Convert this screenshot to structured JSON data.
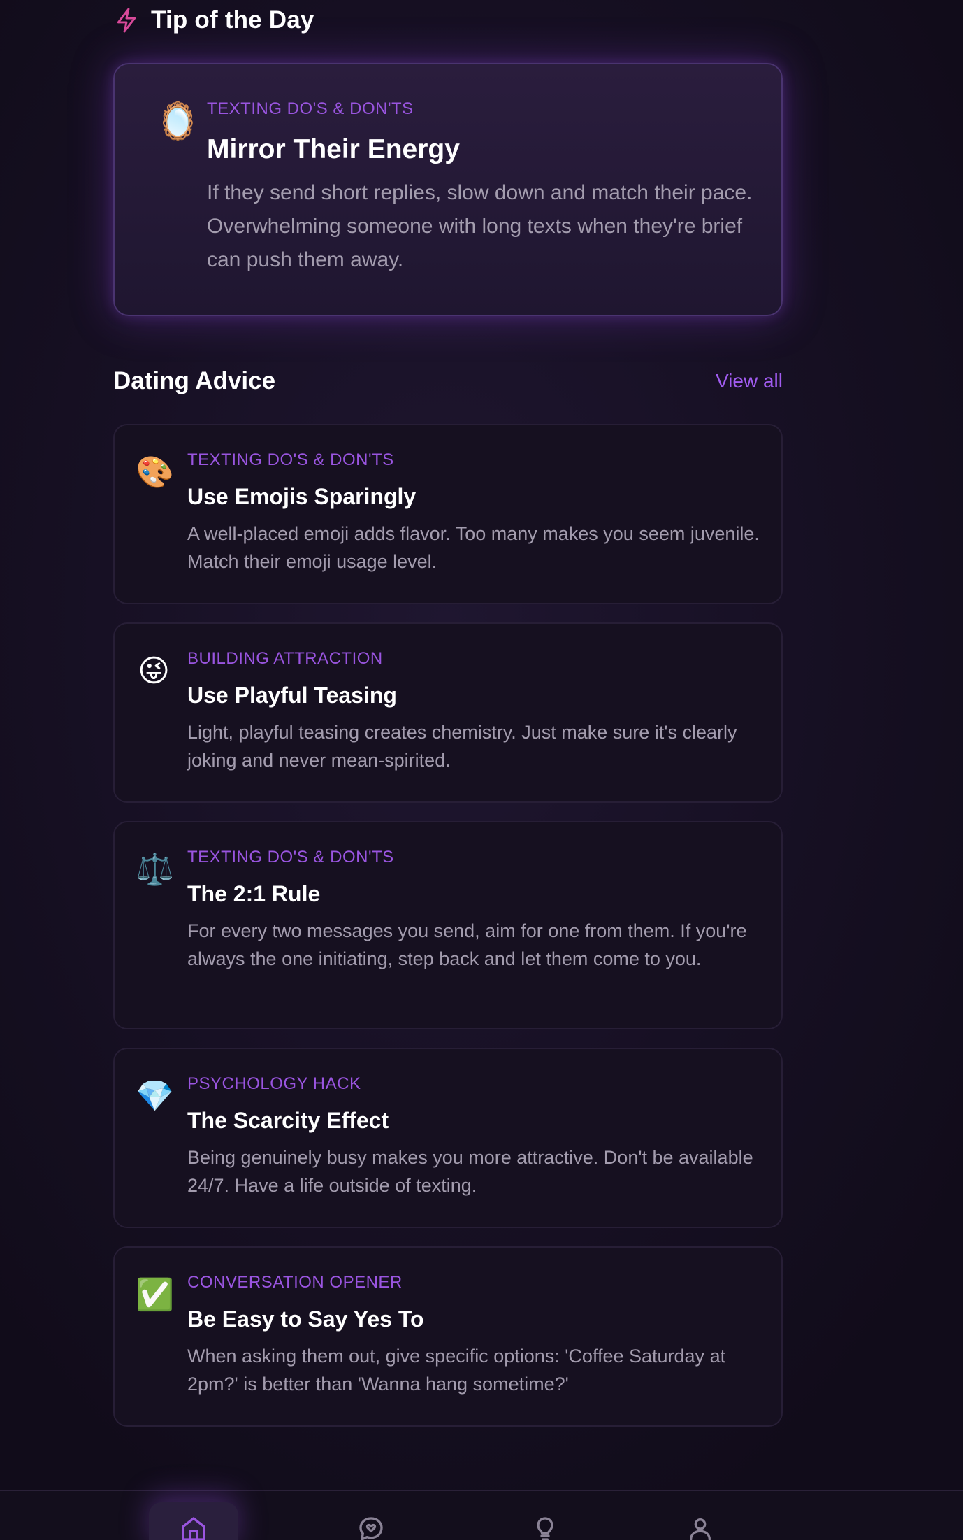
{
  "tip_of_day": {
    "heading": "Tip of the Day",
    "icon": "lightning-bolt-icon",
    "card": {
      "emoji": "🪞",
      "category": "TEXTING DO'S & DON'TS",
      "title": "Mirror Their Energy",
      "description": "If they send short replies, slow down and match their pace. Overwhelming someone with long texts when they're brief can push them away."
    }
  },
  "dating_advice": {
    "heading": "Dating Advice",
    "view_all_label": "View all",
    "items": [
      {
        "emoji": "🎨",
        "category": "TEXTING DO'S & DON'TS",
        "title": "Use Emojis Sparingly",
        "description": "A well-placed emoji adds flavor. Too many makes you seem juvenile. Match their emoji usage level."
      },
      {
        "emoji": "😜",
        "category": "BUILDING ATTRACTION",
        "title": "Use Playful Teasing",
        "description": "Light, playful teasing creates chemistry. Just make sure it's clearly joking and never mean-spirited."
      },
      {
        "emoji": "⚖️",
        "category": "TEXTING DO'S & DON'TS",
        "title": "The 2:1 Rule",
        "description": "For every two messages you send, aim for one from them. If you're always the one initiating, step back and let them come to you."
      },
      {
        "emoji": "💎",
        "category": "PSYCHOLOGY HACK",
        "title": "The Scarcity Effect",
        "description": "Being genuinely busy makes you more attractive. Don't be available 24/7. Have a life outside of texting."
      },
      {
        "emoji": "✅",
        "category": "CONVERSATION OPENER",
        "title": "Be Easy to Say Yes To",
        "description": "When asking them out, give specific options: 'Coffee Saturday at 2pm?' is better than 'Wanna hang sometime?'"
      }
    ]
  },
  "bottom_nav": {
    "items": [
      {
        "icon": "home-icon",
        "active": true
      },
      {
        "icon": "chat-heart-icon",
        "active": false
      },
      {
        "icon": "lightbulb-icon",
        "active": false
      },
      {
        "icon": "profile-icon",
        "active": false
      }
    ]
  },
  "colors": {
    "accent": "#9a55e0",
    "bolt": "#d94a9a",
    "background": "#140f1f"
  }
}
